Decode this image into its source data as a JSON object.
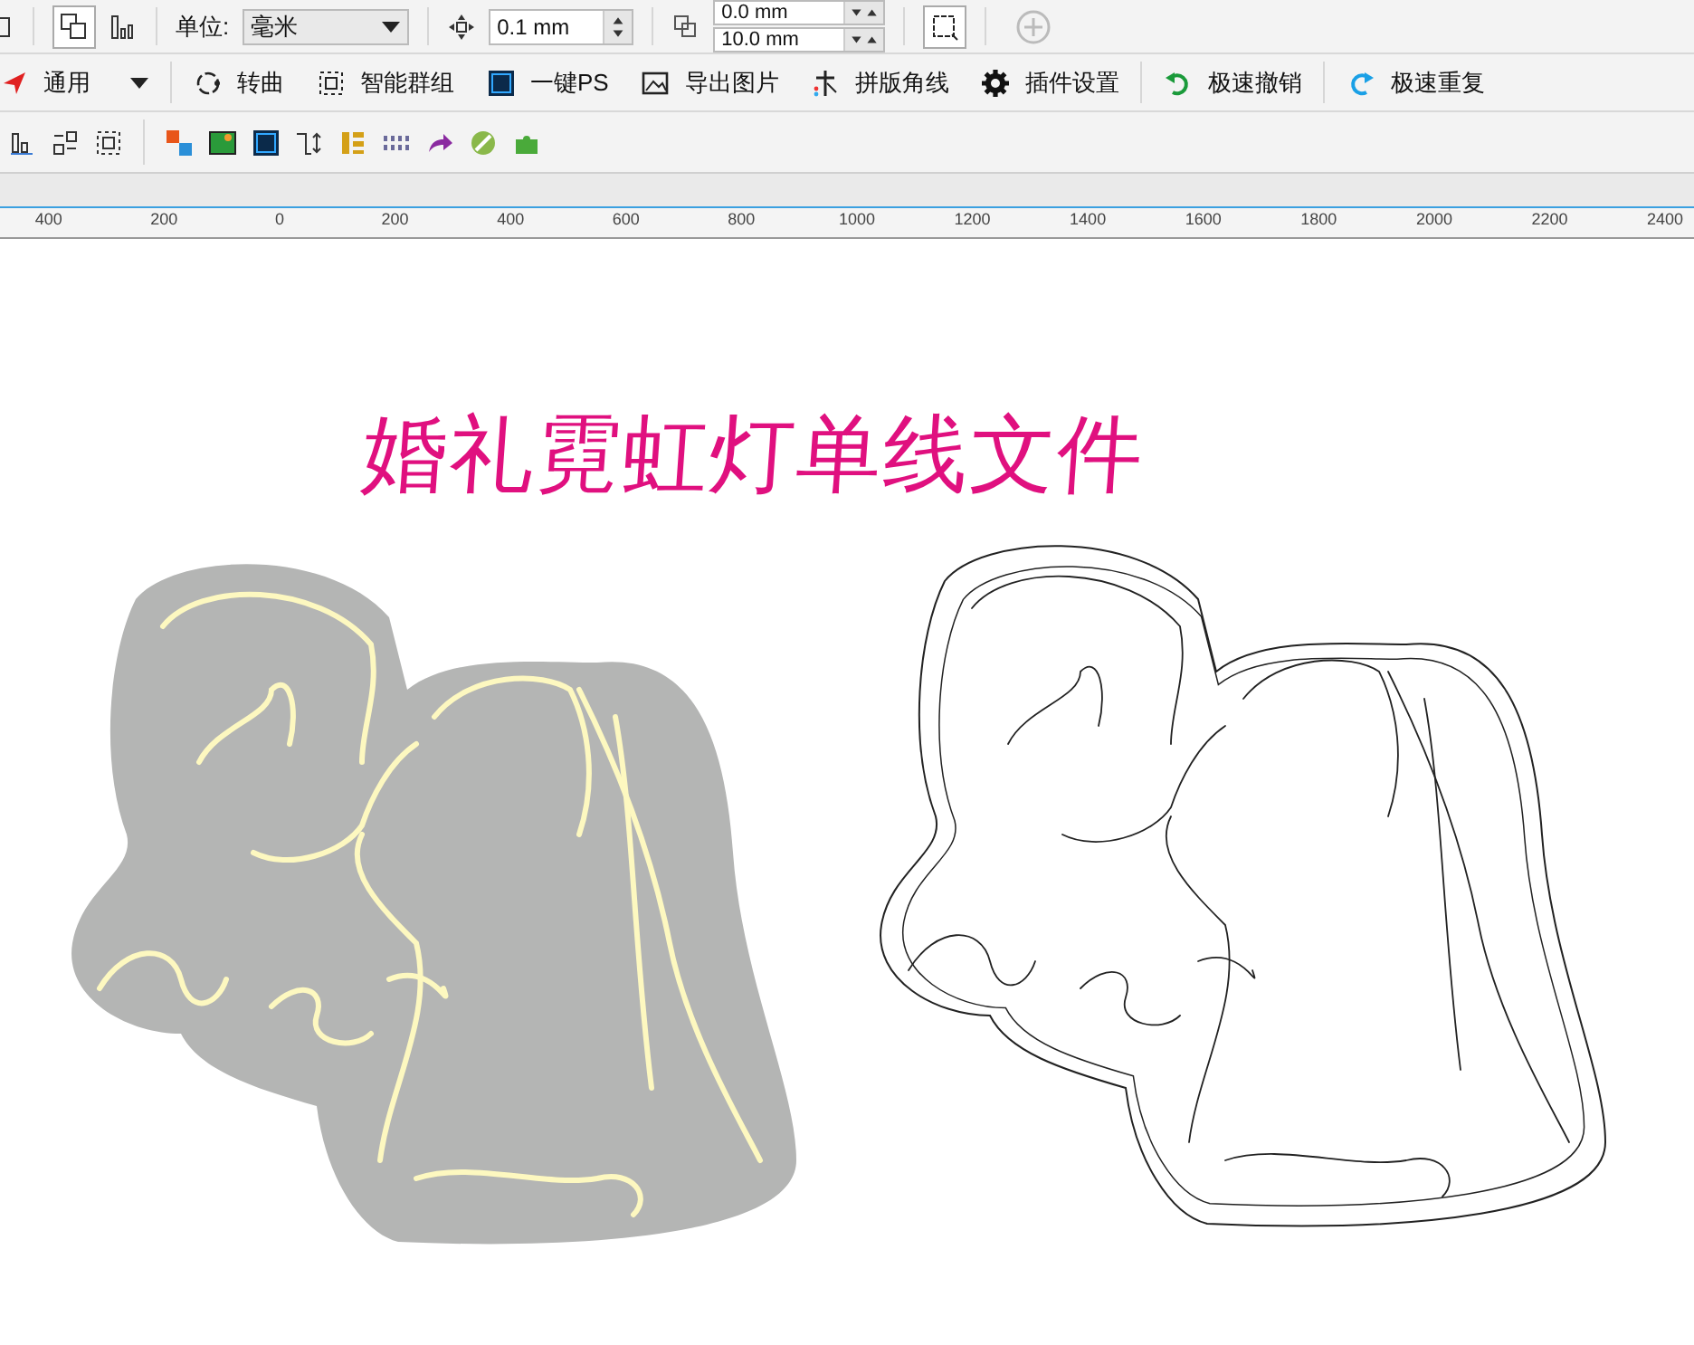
{
  "property_bar": {
    "unit_label": "单位:",
    "unit_value": "毫米",
    "nudge_value": "0.1 mm",
    "duplicate_x": "0.0 mm",
    "duplicate_y": "10.0 mm"
  },
  "plugin_bar": [
    {
      "label": "通用",
      "kind": "dropdown"
    },
    {
      "label": "转曲",
      "kind": "button"
    },
    {
      "label": "智能群组",
      "kind": "button"
    },
    {
      "label": "一键PS",
      "kind": "button"
    },
    {
      "label": "导出图片",
      "kind": "button"
    },
    {
      "label": "拼版角线",
      "kind": "button"
    },
    {
      "label": "插件设置",
      "kind": "button"
    },
    {
      "label": "极速撤销",
      "kind": "button"
    },
    {
      "label": "极速重复",
      "kind": "button"
    }
  ],
  "ruler": [
    "400",
    "200",
    "0",
    "200",
    "400",
    "600",
    "800",
    "1000",
    "1200",
    "1400",
    "1600",
    "1800",
    "2000",
    "2200",
    "2400"
  ],
  "canvas": {
    "title": "婚礼霓虹灯单线文件"
  }
}
